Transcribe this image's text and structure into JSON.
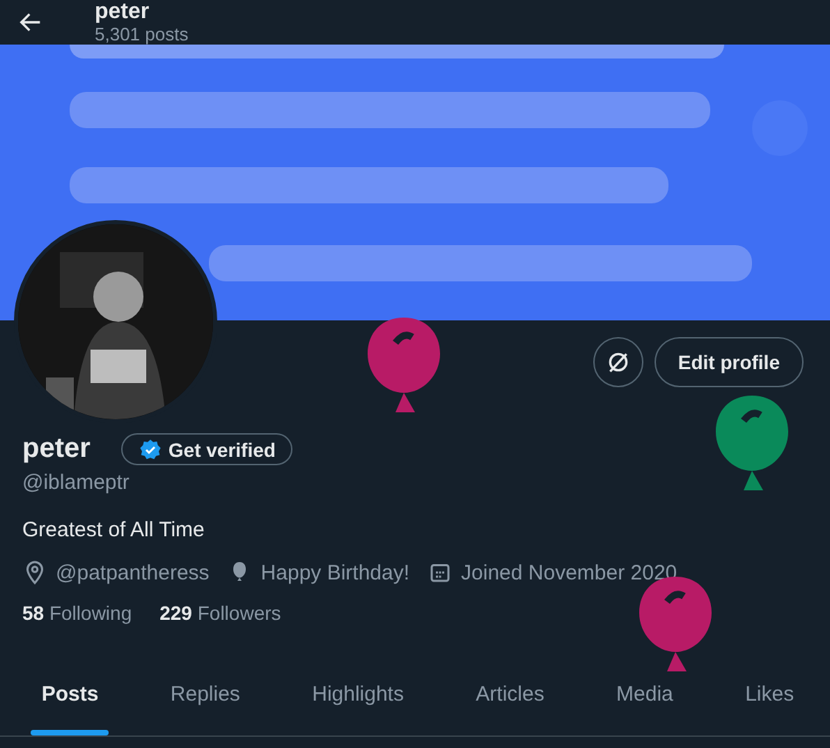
{
  "header": {
    "title": "peter",
    "post_count": "5,301 posts"
  },
  "profile": {
    "name": "peter",
    "verify_button": "Get verified",
    "handle": "@iblameptr",
    "bio": "Greatest of All Time",
    "edit_button": "Edit profile",
    "meta": [
      {
        "kind": "location",
        "text": "@patpantheress"
      },
      {
        "kind": "birthday",
        "text": "Happy Birthday!"
      },
      {
        "kind": "joined",
        "text": "Joined November 2020"
      }
    ],
    "stats": [
      {
        "count": "58",
        "label": "Following"
      },
      {
        "count": "229",
        "label": "Followers"
      }
    ]
  },
  "tabs": [
    {
      "label": "Posts",
      "selected": true
    },
    {
      "label": "Replies",
      "selected": false
    },
    {
      "label": "Highlights",
      "selected": false
    },
    {
      "label": "Articles",
      "selected": false
    },
    {
      "label": "Media",
      "selected": false
    },
    {
      "label": "Likes",
      "selected": false
    }
  ]
}
